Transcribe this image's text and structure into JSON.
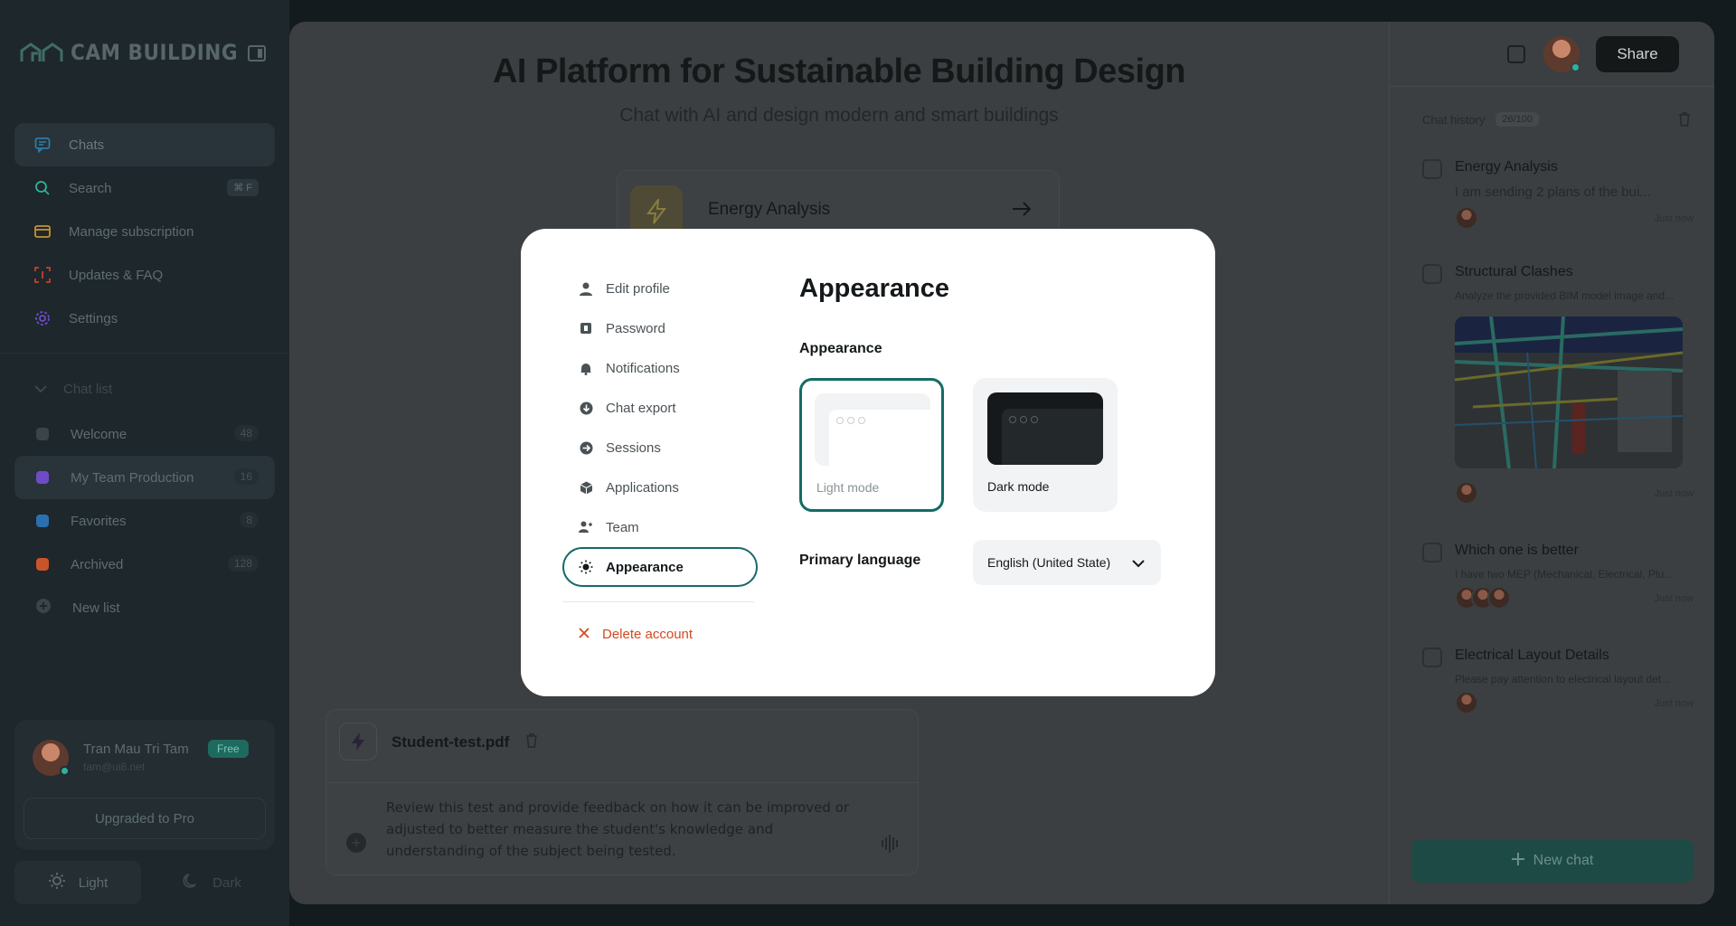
{
  "app": {
    "brand": "CAM BUILDING"
  },
  "sidebar": {
    "nav": [
      {
        "label": "Chats",
        "icon": "chat-icon",
        "color": "#2c7ba8"
      },
      {
        "label": "Search",
        "icon": "search-icon",
        "shortcut": "⌘ F",
        "color": "#2bb39d"
      },
      {
        "label": "Manage subscription",
        "icon": "card-icon",
        "color": "#c8912f"
      },
      {
        "label": "Updates & FAQ",
        "icon": "scan-icon",
        "color": "#c0432a"
      },
      {
        "label": "Settings",
        "icon": "gear-icon",
        "color": "#6f4cc6"
      }
    ],
    "list_header": "Chat list",
    "lists": [
      {
        "label": "Welcome",
        "count": "48",
        "color": "#3a4449"
      },
      {
        "label": "My Team Production",
        "count": "16",
        "color": "#6f4cc6"
      },
      {
        "label": "Favorites",
        "count": "8",
        "color": "#2c6fb0"
      },
      {
        "label": "Archived",
        "count": "128",
        "color": "#c8552a"
      }
    ],
    "new_list": "New list",
    "user": {
      "name": "Tran Mau Tri Tam",
      "email": "tam@ui8.net",
      "plan": "Free"
    },
    "upgrade": "Upgraded to Pro",
    "theme": {
      "light": "Light",
      "dark": "Dark"
    }
  },
  "main": {
    "title": "AI Platform for Sustainable Building Design",
    "subtitle": "Chat with AI and design modern and smart buildings",
    "card": {
      "title": "Energy Analysis"
    },
    "composer": {
      "file": "Student-test.pdf",
      "text": "Review this test and provide feedback on how it can be improved or adjusted to better measure the student's knowledge and understanding of the subject being tested."
    }
  },
  "right_panel": {
    "share": "Share",
    "history_label": "Chat history",
    "history_count": "26/100",
    "items": [
      {
        "title": "Energy Analysis",
        "desc": "I am sending 2 plans of the bui...",
        "time": "Just now"
      },
      {
        "title": "Structural Clashes",
        "desc": "Analyze the provided BIM model image and...",
        "time": "Just now"
      },
      {
        "title": "Which one is better",
        "desc": "I have two MEP (Mechanical, Electrical, Plu...",
        "time": "Just now"
      },
      {
        "title": "Electrical Layout Details",
        "desc": "Please pay attention to electrical layout det...",
        "time": "Just now"
      }
    ],
    "new_chat": "New chat"
  },
  "modal": {
    "nav": [
      {
        "label": "Edit profile",
        "icon": "user-icon"
      },
      {
        "label": "Password",
        "icon": "lock-icon"
      },
      {
        "label": "Notifications",
        "icon": "bell-icon"
      },
      {
        "label": "Chat export",
        "icon": "download-icon"
      },
      {
        "label": "Sessions",
        "icon": "arrow-circle-icon"
      },
      {
        "label": "Applications",
        "icon": "cube-icon"
      },
      {
        "label": "Team",
        "icon": "team-icon"
      },
      {
        "label": "Appearance",
        "icon": "sun-icon",
        "active": true
      }
    ],
    "delete": "Delete account",
    "title": "Appearance",
    "section": "Appearance",
    "options": {
      "light": "Light mode",
      "dark": "Dark mode",
      "selected": "light"
    },
    "language_label": "Primary language",
    "language_value": "English (United State)",
    "accent": "#146b66",
    "danger": "#d4491f"
  }
}
